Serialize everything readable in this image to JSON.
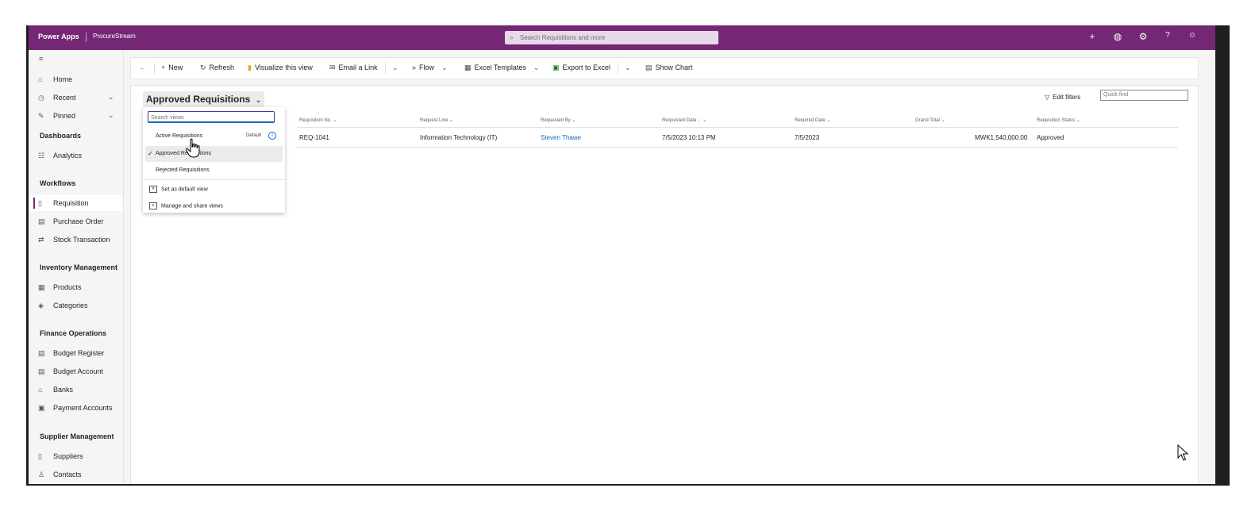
{
  "topbar": {
    "brand": "Power Apps",
    "app_name": "ProcureStream",
    "search_placeholder": "Search Requisitions and more",
    "icons": [
      "plus-icon",
      "globe-icon",
      "gear-icon",
      "help-icon",
      "user-icon"
    ]
  },
  "sidebar": {
    "menu_icon": "hamburger-icon",
    "top_items": [
      {
        "label": "Home",
        "icon": "home-icon"
      },
      {
        "label": "Recent",
        "icon": "clock-icon"
      },
      {
        "label": "Pinned",
        "icon": "pin-icon"
      }
    ],
    "sections": [
      {
        "title": "Dashboards",
        "items": [
          {
            "label": "Analytics"
          }
        ]
      },
      {
        "title": "Workflows",
        "items": [
          {
            "label": "Requisition",
            "active": true
          },
          {
            "label": "Purchase Order"
          },
          {
            "label": "Stock Transaction"
          }
        ]
      },
      {
        "title": "Inventory Management",
        "items": [
          {
            "label": "Products"
          },
          {
            "label": "Categories"
          }
        ]
      },
      {
        "title": "Finance Operations",
        "items": [
          {
            "label": "Budget Register"
          },
          {
            "label": "Budget Account"
          },
          {
            "label": "Banks"
          },
          {
            "label": "Payment Accounts"
          }
        ]
      },
      {
        "title": "Supplier Management",
        "items": [
          {
            "label": "Suppliers"
          },
          {
            "label": "Contacts"
          }
        ]
      }
    ]
  },
  "commandbar": {
    "back": "←",
    "new": "New",
    "refresh": "Refresh",
    "visualize": "Visualize this view",
    "email": "Email a Link",
    "flow": "Flow",
    "excel_templates": "Excel Templates",
    "export": "Export to Excel",
    "show_chart": "Show Chart"
  },
  "view": {
    "title": "Approved Requisitions",
    "edit_filters": "Edit filters",
    "quick_find_placeholder": "Quick find"
  },
  "dropdown": {
    "search_placeholder": "Search views",
    "views": [
      {
        "label": "Active Requisitions",
        "badge": "Default"
      },
      {
        "label": "Approved Requisitions",
        "selected": true
      },
      {
        "label": "Rejected Requisitions"
      }
    ],
    "actions": [
      "Set as default view",
      "Manage and share views"
    ]
  },
  "grid": {
    "columns": [
      "Requisition No.",
      "Request Line",
      "Requested By",
      "Requested Date",
      "Required Date",
      "Grand Total",
      "Requisition Status"
    ],
    "rows": [
      {
        "requisition_no": "REQ-1041",
        "request_line": "Information Technology (IT)",
        "requested_by": "Steven Thawe",
        "requested_date": "7/5/2023 10:13 PM",
        "required_date": "7/5/2023",
        "grand_total": "MWK1,540,000.00",
        "status": "Approved"
      }
    ]
  },
  "colors": {
    "brand": "#742774",
    "link": "#0f6cbd"
  }
}
